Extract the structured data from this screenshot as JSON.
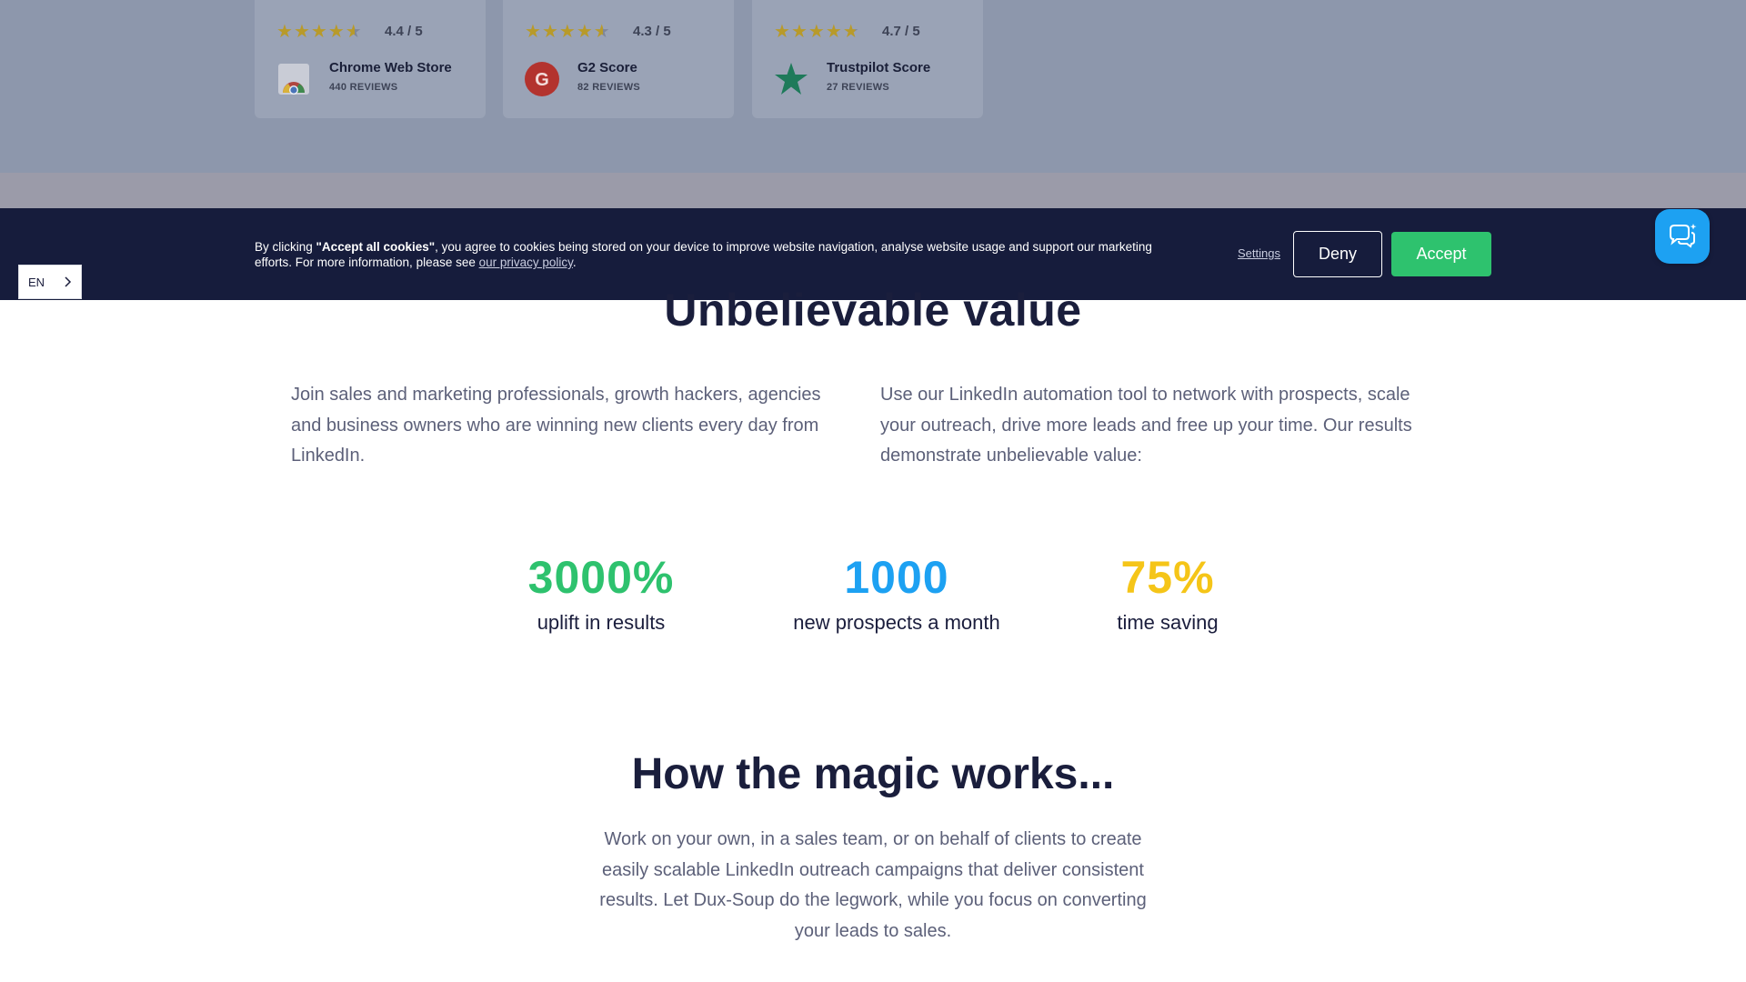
{
  "ratings": [
    {
      "score": "4.4 / 5",
      "name": "Chrome Web Store",
      "reviews": "440 REVIEWS",
      "stars": 4.4,
      "logo": "chrome-icon"
    },
    {
      "score": "4.3 / 5",
      "name": "G2 Score",
      "reviews": "82 REVIEWS",
      "stars": 4.3,
      "logo": "g2-icon"
    },
    {
      "score": "4.7 / 5",
      "name": "Trustpilot Score",
      "reviews": "27 REVIEWS",
      "stars": 4.7,
      "logo": "trustpilot-star-icon"
    }
  ],
  "cookie": {
    "prefix": "By clicking ",
    "bold": "\"Accept all cookies\"",
    "middle": ", you agree to cookies being stored on your device to improve website navigation, analyse website usage and support our marketing efforts. For more information, please see ",
    "link": "our privacy policy",
    "suffix": ".",
    "settings": "Settings",
    "deny": "Deny",
    "accept": "Accept"
  },
  "language": {
    "selected": "EN",
    "icon": "chevron-right-icon"
  },
  "chat": {
    "icon": "chat-bubbles-icon",
    "color": "#1da1f2"
  },
  "value_section": {
    "title": "Unbelievable value",
    "left": "Join sales and marketing professionals, growth hackers, agencies and business owners who are winning new clients every day from LinkedIn.",
    "right": "Use our LinkedIn automation tool to network with prospects, scale your outreach, drive more leads and free up your time. Our results demonstrate unbelievable value:"
  },
  "stats": [
    {
      "value": "3000%",
      "label": "uplift in results",
      "color": "#2ec26e"
    },
    {
      "value": "1000",
      "label": "new prospects a month",
      "color": "#1da1f2"
    },
    {
      "value": "75%",
      "label": "time saving",
      "color": "#f5c518"
    }
  ],
  "magic_section": {
    "title": "How the magic works...",
    "text": "Work on your own, in a sales team, or on behalf of clients to create easily scalable LinkedIn outreach campaigns that deliver consistent results. Let Dux-Soup do the legwork, while you focus on converting your leads to sales."
  }
}
